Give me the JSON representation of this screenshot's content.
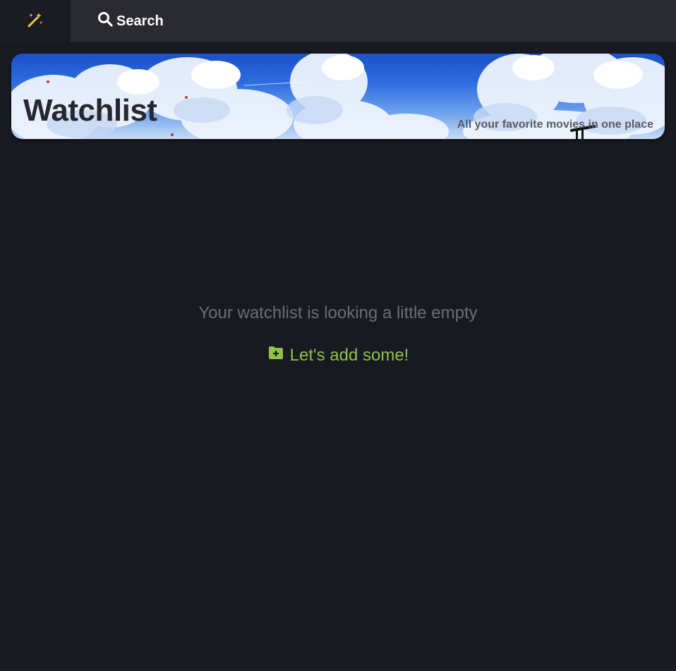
{
  "nav": {
    "logo_icon": "magic-wand-icon",
    "logo_color": "#f5c542",
    "search_label": "Search",
    "search_icon": "search-icon"
  },
  "banner": {
    "title": "Watchlist",
    "subtitle": "All your favorite movies in one place"
  },
  "empty_state": {
    "message": "Your watchlist is looking a little empty",
    "action_label": "Let's add some!",
    "action_icon": "folder-plus-icon",
    "action_color": "#8bc34a"
  }
}
